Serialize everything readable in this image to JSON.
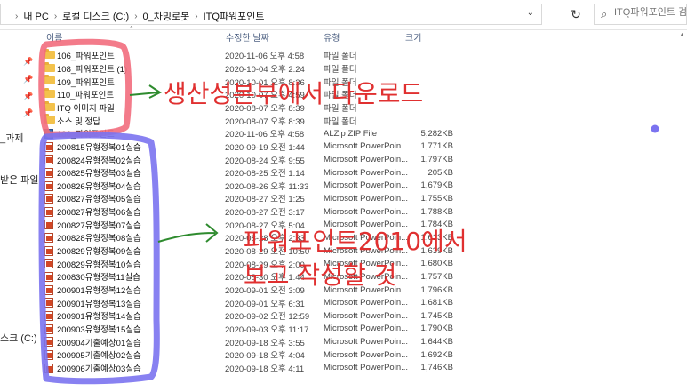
{
  "window": {
    "breadcrumb": [
      "내 PC",
      "로컬 디스크 (C:)",
      "0_차밍로봇",
      "ITQ파워포인트"
    ],
    "search_placeholder": "ITQ파워포인트 검색"
  },
  "sidebar": {
    "items": [
      "_과제",
      "받은 파일",
      "스크 (C:)"
    ]
  },
  "columns": {
    "name": "이름",
    "date": "수정한 날짜",
    "type": "유형",
    "size": "크기"
  },
  "files": [
    {
      "icon": "folder-icon",
      "name": "106_파워포인트",
      "date": "2020-11-06 오후 4:58",
      "type": "파일 폴더",
      "size": ""
    },
    {
      "icon": "folder-icon",
      "name": "108_파워포인트 (1)",
      "date": "2020-10-04 오후 2:24",
      "type": "파일 폴더",
      "size": ""
    },
    {
      "icon": "folder-icon",
      "name": "109_파워포인트",
      "date": "2020-10-01 오후 8:36",
      "type": "파일 폴더",
      "size": ""
    },
    {
      "icon": "folder-icon",
      "name": "110_파워포인트",
      "date": "2020-10-07 오후 4:59",
      "type": "파일 폴더",
      "size": ""
    },
    {
      "icon": "folder-icon",
      "name": "ITQ 이미지 파일",
      "date": "2020-08-07 오후 8:39",
      "type": "파일 폴더",
      "size": ""
    },
    {
      "icon": "folder-icon",
      "name": "소스 및 정답",
      "date": "2020-08-07 오후 8:39",
      "type": "파일 폴더",
      "size": ""
    },
    {
      "icon": "zip-icon",
      "name": "106_파워포인트",
      "date": "2020-11-06 오후 4:58",
      "type": "ALZip ZIP File",
      "size": "5,282KB"
    },
    {
      "icon": "ppt-icon",
      "name": "200815유형정복01실습",
      "date": "2020-09-19 오전 1:44",
      "type": "Microsoft PowerPoin...",
      "size": "1,771KB"
    },
    {
      "icon": "ppt-icon",
      "name": "200824유형정복02실습",
      "date": "2020-08-24 오후 9:55",
      "type": "Microsoft PowerPoin...",
      "size": "1,797KB"
    },
    {
      "icon": "ppt-icon",
      "name": "200825유형정복03실습",
      "date": "2020-08-25 오전 1:14",
      "type": "Microsoft PowerPoin...",
      "size": "205KB"
    },
    {
      "icon": "ppt-icon",
      "name": "200826유형정복04실습",
      "date": "2020-08-26 오후 11:33",
      "type": "Microsoft PowerPoin...",
      "size": "1,679KB"
    },
    {
      "icon": "ppt-icon",
      "name": "200827유형정복05실습",
      "date": "2020-08-27 오전 1:25",
      "type": "Microsoft PowerPoin...",
      "size": "1,755KB"
    },
    {
      "icon": "ppt-icon",
      "name": "200827유형정복06실습",
      "date": "2020-08-27 오전 3:17",
      "type": "Microsoft PowerPoin...",
      "size": "1,788KB"
    },
    {
      "icon": "ppt-icon",
      "name": "200827유형정복07실습",
      "date": "2020-08-27 오후 5:04",
      "type": "Microsoft PowerPoin...",
      "size": "1,784KB"
    },
    {
      "icon": "ppt-icon",
      "name": "200828유형정복08실습",
      "date": "2020-08-28 오후 2:33",
      "type": "Microsoft PowerPoin...",
      "size": "1,613KB"
    },
    {
      "icon": "ppt-icon",
      "name": "200829유형정복09실습",
      "date": "2020-08-29 오전 10:50",
      "type": "Microsoft PowerPoin...",
      "size": "1,639KB"
    },
    {
      "icon": "ppt-icon",
      "name": "200829유형정복10실습",
      "date": "2020-08-29 오후 2:00",
      "type": "Microsoft PowerPoin...",
      "size": "1,680KB"
    },
    {
      "icon": "ppt-icon",
      "name": "200830유형정복11실습",
      "date": "2020-08-30 오후 1:44",
      "type": "Microsoft PowerPoin...",
      "size": "1,757KB"
    },
    {
      "icon": "ppt-icon",
      "name": "200901유형정복12실습",
      "date": "2020-09-01 오전 3:09",
      "type": "Microsoft PowerPoin...",
      "size": "1,796KB"
    },
    {
      "icon": "ppt-icon",
      "name": "200901유형정복13실습",
      "date": "2020-09-01 오후 6:31",
      "type": "Microsoft PowerPoin...",
      "size": "1,681KB"
    },
    {
      "icon": "ppt-icon",
      "name": "200901유형정복14실습",
      "date": "2020-09-02 오전 12:59",
      "type": "Microsoft PowerPoin...",
      "size": "1,745KB"
    },
    {
      "icon": "ppt-icon",
      "name": "200903유형정복15실습",
      "date": "2020-09-03 오후 11:17",
      "type": "Microsoft PowerPoin...",
      "size": "1,790KB"
    },
    {
      "icon": "ppt-icon",
      "name": "200904기출예상01실습",
      "date": "2020-09-18 오후 3:55",
      "type": "Microsoft PowerPoin...",
      "size": "1,644KB"
    },
    {
      "icon": "ppt-icon",
      "name": "200905기출예상02실습",
      "date": "2020-09-18 오후 4:04",
      "type": "Microsoft PowerPoin...",
      "size": "1,692KB"
    },
    {
      "icon": "ppt-icon",
      "name": "200906기출예상03실습",
      "date": "2020-09-18 오후 4:11",
      "type": "Microsoft PowerPoin...",
      "size": "1,746KB"
    }
  ],
  "annotations": {
    "top_note": "생산성본부에서 다운로드",
    "bottom_note_line1": "파워포인트2010에서",
    "bottom_note_line2": "보고 작성할 것",
    "colors": {
      "pink": "#f26d7d",
      "purple": "#7b73f0",
      "green": "#2e8b2e",
      "red": "#e03030"
    }
  }
}
